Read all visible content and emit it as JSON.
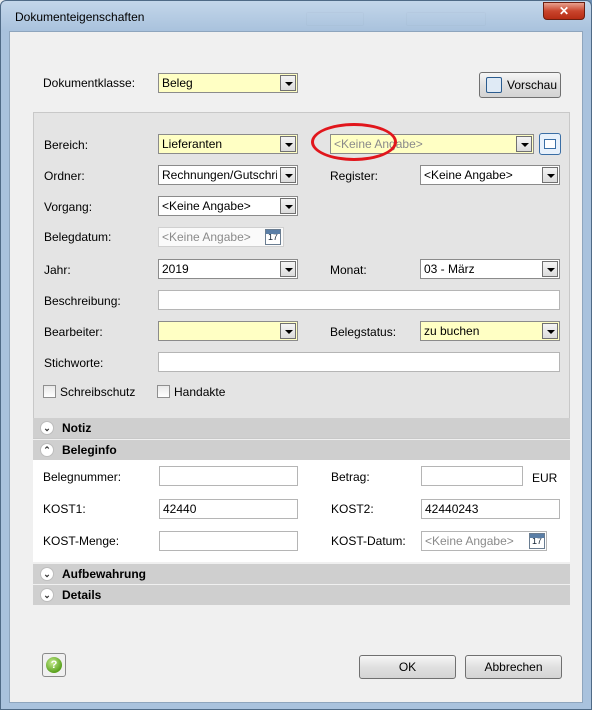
{
  "window": {
    "title": "Dokumenteigenschaften",
    "close_glyph": "✕"
  },
  "header": {
    "dokumentklasse_label": "Dokumentklasse:",
    "dokumentklasse_value": "Beleg",
    "vorschau_label": "Vorschau"
  },
  "form": {
    "bereich_label": "Bereich:",
    "bereich_value": "Lieferanten",
    "bereich2_value": "<Keine Angabe>",
    "ordner_label": "Ordner:",
    "ordner_value": "Rechnungen/Gutschrifte",
    "register_label": "Register:",
    "register_value": "<Keine Angabe>",
    "vorgang_label": "Vorgang:",
    "vorgang_value": "<Keine Angabe>",
    "belegdatum_label": "Belegdatum:",
    "belegdatum_value": "<Keine Angabe>",
    "jahr_label": "Jahr:",
    "jahr_value": "2019",
    "monat_label": "Monat:",
    "monat_value": "03 - März",
    "beschreibung_label": "Beschreibung:",
    "beschreibung_value": "",
    "bearbeiter_label": "Bearbeiter:",
    "bearbeiter_value": "",
    "belegstatus_label": "Belegstatus:",
    "belegstatus_value": "zu buchen",
    "stichworte_label": "Stichworte:",
    "stichworte_value": "",
    "schreibschutz_label": "Schreibschutz",
    "handakte_label": "Handakte",
    "calendar_day": "17"
  },
  "sections": {
    "notiz": "Notiz",
    "beleginfo": "Beleginfo",
    "aufbewahrung": "Aufbewahrung",
    "details": "Details"
  },
  "beleginfo": {
    "belegnummer_label": "Belegnummer:",
    "belegnummer_value": "",
    "betrag_label": "Betrag:",
    "betrag_value": "",
    "currency": "EUR",
    "kost1_label": "KOST1:",
    "kost1_value": "42440",
    "kost2_label": "KOST2:",
    "kost2_value": "42440243",
    "kost_menge_label": "KOST-Menge:",
    "kost_menge_value": "",
    "kost_datum_label": "KOST-Datum:",
    "kost_datum_value": "<Keine Angabe>"
  },
  "footer": {
    "ok_label": "OK",
    "abbrechen_label": "Abbrechen",
    "help_glyph": "?"
  },
  "colors": {
    "required_field": "#ffffc4",
    "annotation_ellipse": "#e1161c"
  }
}
